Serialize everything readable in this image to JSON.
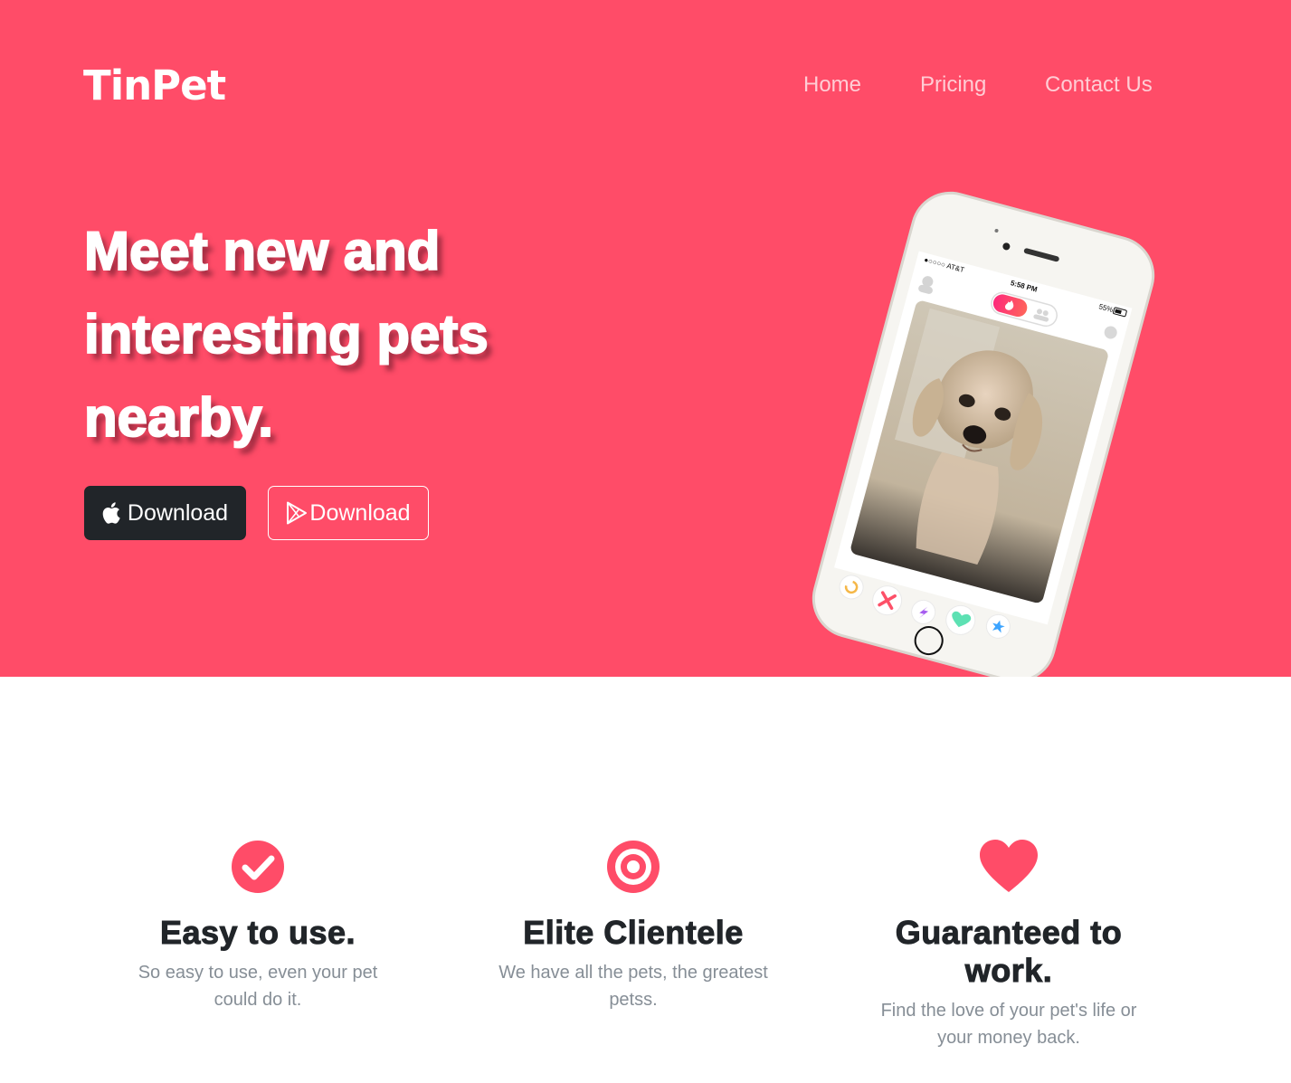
{
  "brand": "TinPet",
  "nav": {
    "home": "Home",
    "pricing": "Pricing",
    "contact": "Contact Us"
  },
  "hero": {
    "headline_lines": [
      "Meet new and",
      "interesting pets",
      "nearby."
    ],
    "apple_button": "Download",
    "google_button": "Download"
  },
  "phone": {
    "carrier": "●○○○○ AT&T",
    "time": "5:58 PM",
    "battery": "55%"
  },
  "features": [
    {
      "title": "Easy to use.",
      "text": "So easy to use, even your pet could do it.",
      "icon": "check-circle-icon"
    },
    {
      "title": "Elite Clientele",
      "text": "We have all the pets, the greatest petss.",
      "icon": "target-icon"
    },
    {
      "title": "Guaranteed to work.",
      "text": "Find the love of your pet's life or your money back.",
      "icon": "heart-icon"
    }
  ],
  "colors": {
    "primary": "#ff4c68",
    "dark_button": "#212529",
    "muted_text": "#868e96"
  }
}
